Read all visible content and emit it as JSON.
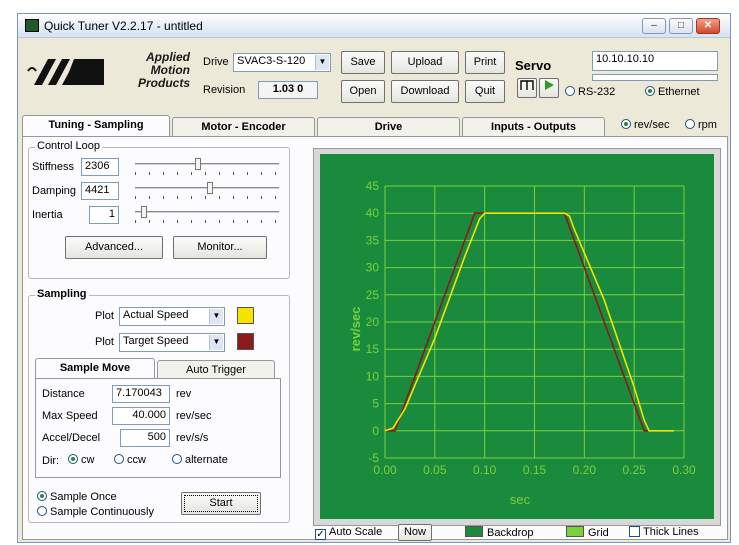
{
  "window": {
    "title": "Quick Tuner  V2.2.17 - untitled"
  },
  "logo": {
    "line1": "Applied",
    "line2": "Motion",
    "line3": "Products"
  },
  "header": {
    "drive_label": "Drive",
    "drive_value": "SVAC3-S-120",
    "revision_label": "Revision",
    "revision_value": "1.03 0",
    "buttons": {
      "save": "Save",
      "upload": "Upload",
      "print": "Print",
      "open": "Open",
      "download": "Download",
      "quit": "Quit"
    },
    "servo_label": "Servo",
    "ip_value": "10.10.10.10",
    "conn_rs232": "RS-232",
    "conn_ethernet": "Ethernet"
  },
  "tabs": {
    "tuning": "Tuning - Sampling",
    "motor": "Motor - Encoder",
    "drive": "Drive",
    "io": "Inputs - Outputs",
    "revsec": "rev/sec",
    "rpm": "rpm"
  },
  "control_loop": {
    "title": "Control Loop",
    "stiffness_label": "Stiffness",
    "stiffness_value": "2306",
    "damping_label": "Damping",
    "damping_value": "4421",
    "inertia_label": "Inertia",
    "inertia_value": "1",
    "advanced_button": "Advanced...",
    "monitor_button": "Monitor..."
  },
  "sampling": {
    "title": "Sampling",
    "plot_label": "Plot",
    "plot1": "Actual Speed",
    "plot1_color": "#f5e400",
    "plot2": "Target Speed",
    "plot2_color": "#8b1a1a",
    "subtab_move": "Sample Move",
    "subtab_trigger": "Auto Trigger",
    "distance_label": "Distance",
    "distance_value": "7.170043",
    "distance_unit": "rev",
    "maxspeed_label": "Max Speed",
    "maxspeed_value": "40.000",
    "maxspeed_unit": "rev/sec",
    "accel_label": "Accel/Decel",
    "accel_value": "500",
    "accel_unit": "rev/s/s",
    "dir_label": "Dir:",
    "dir_cw": "cw",
    "dir_ccw": "ccw",
    "dir_alt": "alternate",
    "once": "Sample Once",
    "continuous": "Sample Continuously",
    "start_button": "Start"
  },
  "bottom": {
    "autoscale": "Auto Scale",
    "now": "Now",
    "backdrop": "Backdrop",
    "backdrop_color": "#1a8a3c",
    "grid": "Grid",
    "grid_color": "#7bd13b",
    "thick": "Thick Lines"
  },
  "chart_data": {
    "type": "line",
    "xlabel": "sec",
    "ylabel": "rev/sec",
    "xlim": [
      0.0,
      0.3
    ],
    "ylim": [
      -5,
      45
    ],
    "xticks": [
      "0.00",
      "0.05",
      "0.10",
      "0.15",
      "0.20",
      "0.25",
      "0.30"
    ],
    "yticks": [
      "-5",
      "0",
      "5",
      "10",
      "15",
      "20",
      "25",
      "30",
      "35",
      "40",
      "45"
    ],
    "grid": true,
    "background": "#1a8a3c",
    "grid_color": "#7bd13b",
    "series": [
      {
        "name": "Actual Speed",
        "color": "#f5e400",
        "x": [
          0.0,
          0.008,
          0.02,
          0.05,
          0.08,
          0.095,
          0.1,
          0.18,
          0.185,
          0.19,
          0.22,
          0.25,
          0.26,
          0.265,
          0.29
        ],
        "y": [
          0,
          0.5,
          4,
          17,
          32,
          39,
          40,
          40,
          39.5,
          37,
          24,
          8,
          2,
          0,
          0
        ]
      },
      {
        "name": "Target Speed",
        "color": "#8b1a1a",
        "x": [
          0.0,
          0.01,
          0.09,
          0.18,
          0.26,
          0.29
        ],
        "y": [
          0,
          0,
          40,
          40,
          0,
          0
        ]
      }
    ]
  }
}
